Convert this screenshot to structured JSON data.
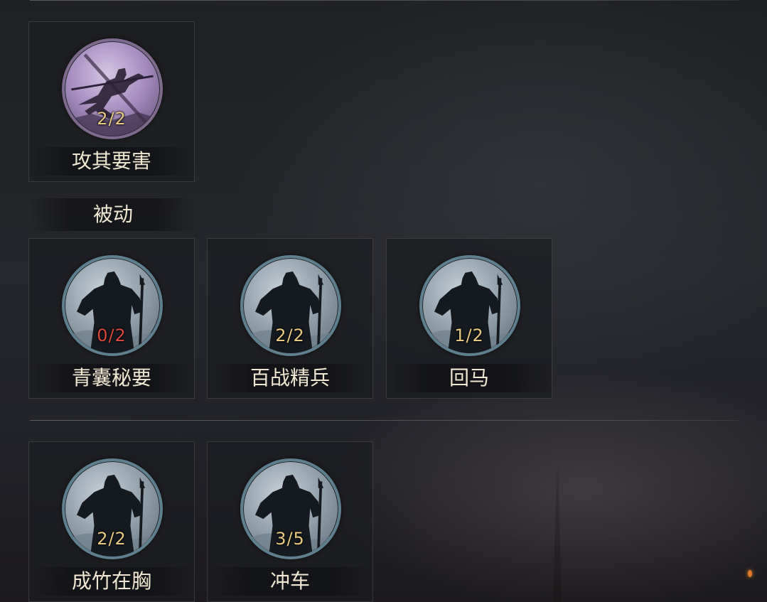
{
  "sections": {
    "top": {
      "skills": [
        {
          "name": "攻其要害",
          "count": "2/2",
          "icon": "ninja-warrior-icon",
          "style": "purple",
          "status": "normal"
        }
      ]
    },
    "passive": {
      "label": "被动",
      "skills": [
        {
          "name": "青囊秘要",
          "count": "0/2",
          "icon": "warrior-icon",
          "style": "blue",
          "status": "warn"
        },
        {
          "name": "百战精兵",
          "count": "2/2",
          "icon": "warrior-icon",
          "style": "blue",
          "status": "normal"
        },
        {
          "name": "回马",
          "count": "1/2",
          "icon": "warrior-icon",
          "style": "blue",
          "status": "normal"
        }
      ]
    },
    "bottom": {
      "skills": [
        {
          "name": "成竹在胸",
          "count": "2/2",
          "icon": "warrior-icon",
          "style": "blue",
          "status": "normal"
        },
        {
          "name": "冲车",
          "count": "3/5",
          "icon": "warrior-icon",
          "style": "blue",
          "status": "normal"
        }
      ]
    }
  },
  "colors": {
    "count": "#e7c980",
    "count_warn": "#d9473d",
    "label": "#f0e7d2",
    "icon_ring_blue": "#5e7f8e",
    "icon_ring_purple": "#7e6a8c"
  }
}
